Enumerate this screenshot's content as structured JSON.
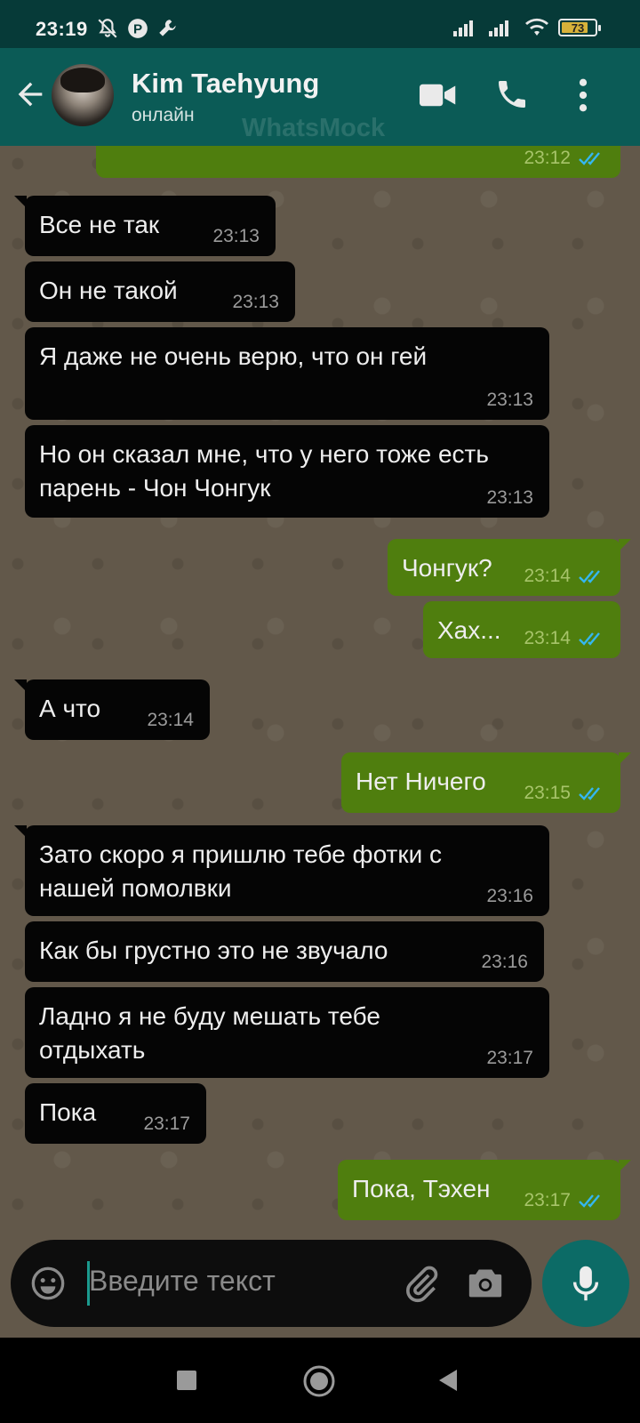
{
  "status_bar": {
    "time": "23:19",
    "battery": "73"
  },
  "header": {
    "contact_name": "Kim Taehyung",
    "contact_status": "онлайн",
    "watermark": "WhatsMock"
  },
  "messages": [
    {
      "dir": "out",
      "text": "",
      "time": "23:12"
    },
    {
      "dir": "in",
      "text": "Все не так",
      "time": "23:13"
    },
    {
      "dir": "in",
      "text": "Он не такой",
      "time": "23:13"
    },
    {
      "dir": "in",
      "text": "Я даже не очень верю, что он гей",
      "time": "23:13"
    },
    {
      "dir": "in",
      "text": "Но он сказал мне, что у него тоже есть парень - Чон Чонгук",
      "time": "23:13"
    },
    {
      "dir": "out",
      "text": "Чонгук?",
      "time": "23:14"
    },
    {
      "dir": "out",
      "text": "Хах...",
      "time": "23:14"
    },
    {
      "dir": "in",
      "text": "А что",
      "time": "23:14"
    },
    {
      "dir": "out",
      "text": "Нет Ничего",
      "time": "23:15"
    },
    {
      "dir": "in",
      "text": "Зато скоро я пришлю тебе фотки с нашей помолвки",
      "time": "23:16"
    },
    {
      "dir": "in",
      "text": "Как бы грустно это не звучало",
      "time": "23:16"
    },
    {
      "dir": "in",
      "text": "Ладно я не буду мешать тебе отдыхать",
      "time": "23:17"
    },
    {
      "dir": "in",
      "text": "Пока",
      "time": "23:17"
    },
    {
      "dir": "out",
      "text": "Пока, Тэхен",
      "time": "23:17"
    }
  ],
  "composer": {
    "placeholder": "Введите текст"
  },
  "colors": {
    "header": "#0b5b56",
    "incoming_bubble": "#050505",
    "outgoing_bubble": "#4f7e0e",
    "read_ticks": "#34b7f1"
  }
}
